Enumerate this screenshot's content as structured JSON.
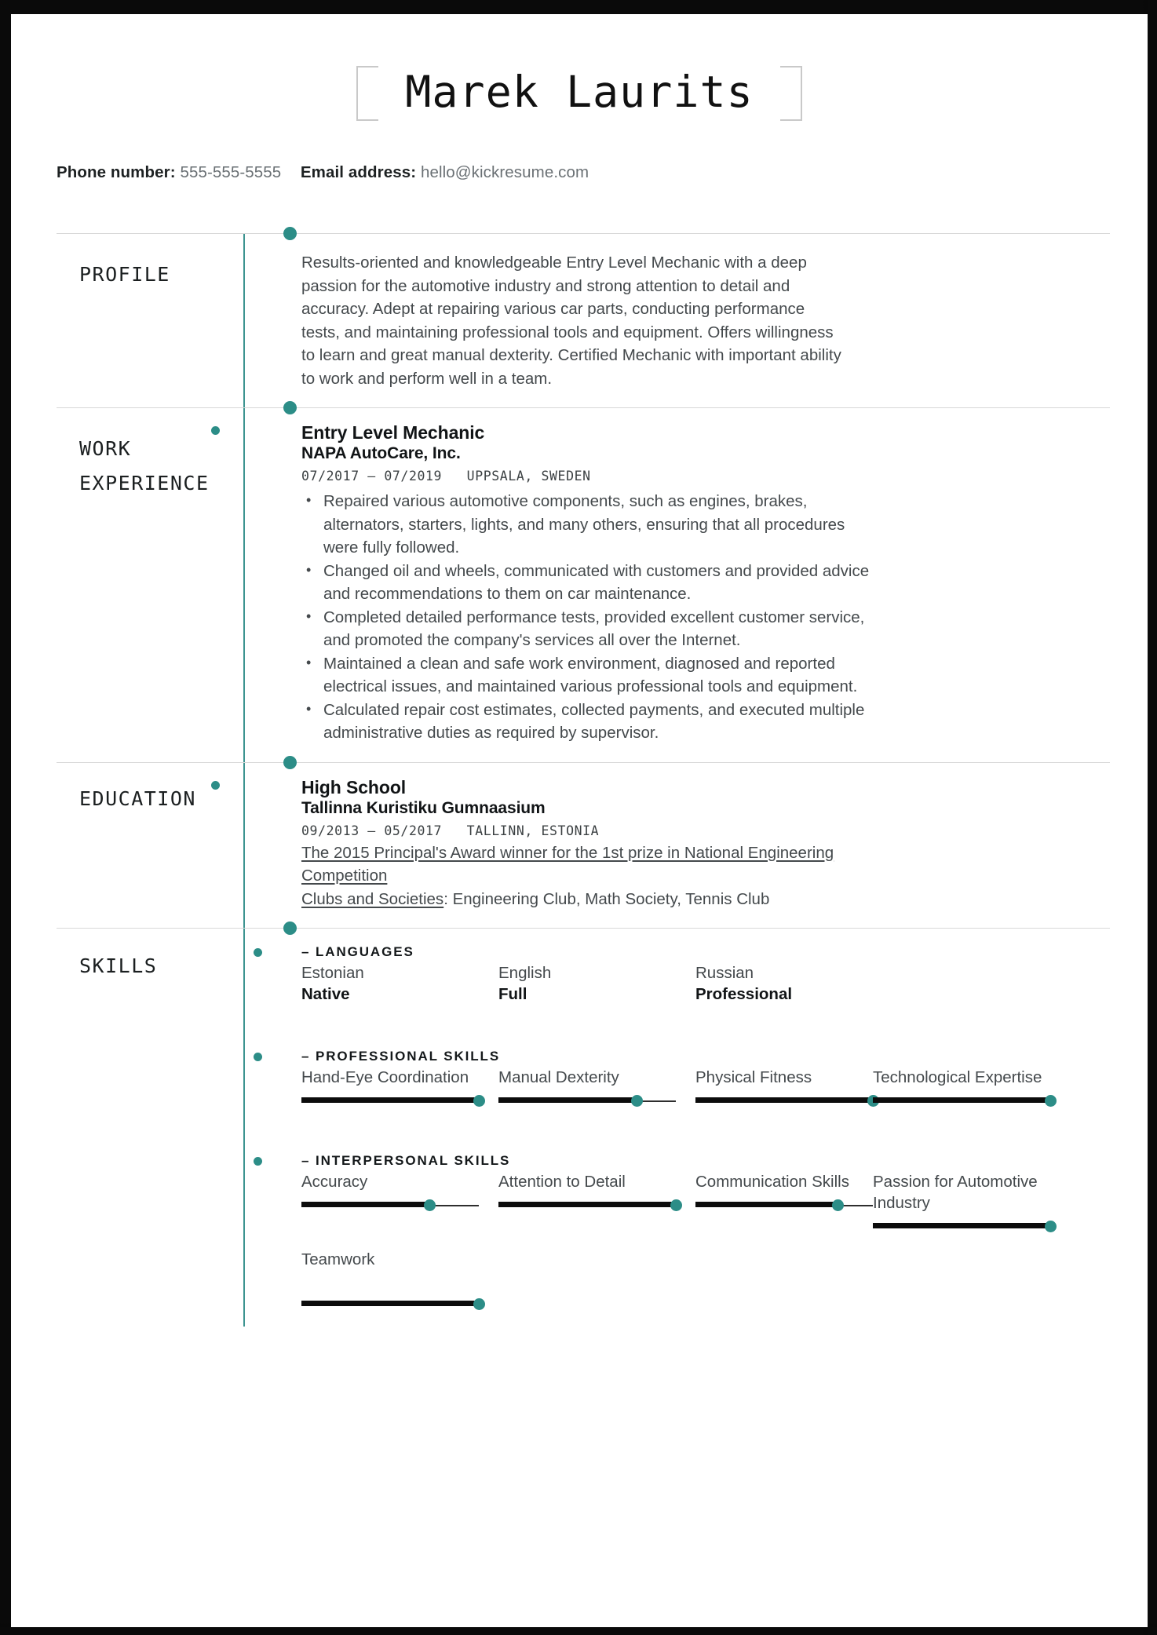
{
  "header": {
    "name": "Marek Laurits",
    "contact": {
      "phone_label": "Phone number:",
      "phone_value": "555-555-5555",
      "email_label": "Email address:",
      "email_value": "hello@kickresume.com"
    }
  },
  "sections": {
    "profile": {
      "label": "PROFILE",
      "text": "Results-oriented and knowledgeable Entry Level Mechanic with a deep passion for the automotive industry and strong attention to detail and accuracy. Adept at repairing various car parts, conducting performance tests, and maintaining professional tools and equipment. Offers willingness to learn and great manual dexterity. Certified Mechanic with important ability to work and perform well in a team."
    },
    "work": {
      "label_line1": "WORK",
      "label_line2": "EXPERIENCE",
      "entries": [
        {
          "title": "Entry Level Mechanic",
          "org": "NAPA AutoCare, Inc.",
          "meta": "07/2017 – 07/2019   UPPSALA, SWEDEN",
          "bullets": [
            "Repaired various automotive components, such as engines, brakes, alternators, starters, lights, and many others, ensuring that all procedures were fully followed.",
            "Changed oil and wheels, communicated with customers and provided advice and recommendations to them on car maintenance.",
            "Completed detailed performance tests, provided excellent customer service, and promoted the company's services all over the Internet.",
            "Maintained a clean and safe work environment, diagnosed and reported electrical issues, and maintained various professional tools and equipment.",
            "Calculated repair cost estimates, collected payments, and executed multiple administrative duties as required by supervisor."
          ]
        }
      ]
    },
    "education": {
      "label": "EDUCATION",
      "entries": [
        {
          "title": "High School",
          "org": "Tallinna Kuristiku Gumnaasium",
          "meta": "09/2013 – 05/2017   TALLINN, ESTONIA",
          "award": "The 2015 Principal's Award winner for the 1st prize in National Engineering Competition",
          "clubs_label": "Clubs and Societies",
          "clubs_value": ": Engineering Club, Math Society, Tennis Club"
        }
      ]
    },
    "skills": {
      "label": "SKILLS",
      "groups": [
        {
          "heading": "– LANGUAGES",
          "type": "languages",
          "items": [
            {
              "name": "Estonian",
              "level": "Native"
            },
            {
              "name": "English",
              "level": "Full"
            },
            {
              "name": "Russian",
              "level": "Professional"
            }
          ]
        },
        {
          "heading": "– PROFESSIONAL SKILLS",
          "type": "bars",
          "items": [
            {
              "name": "Hand-Eye Coordination",
              "value": 100
            },
            {
              "name": "Manual Dexterity",
              "value": 78
            },
            {
              "name": "Physical Fitness",
              "value": 100
            },
            {
              "name": "Technological Expertise",
              "value": 100
            }
          ]
        },
        {
          "heading": "– INTERPERSONAL SKILLS",
          "type": "bars",
          "items": [
            {
              "name": "Accuracy",
              "value": 72
            },
            {
              "name": "Attention to Detail",
              "value": 100
            },
            {
              "name": "Communication Skills",
              "value": 80
            },
            {
              "name": "Passion for Automotive Industry",
              "value": 100
            },
            {
              "name": "Teamwork",
              "value": 100
            }
          ]
        }
      ]
    }
  },
  "colors": {
    "accent": "#2c8d87",
    "text": "#44494c",
    "heading": "#111416",
    "bar": "#0c0c0c"
  }
}
